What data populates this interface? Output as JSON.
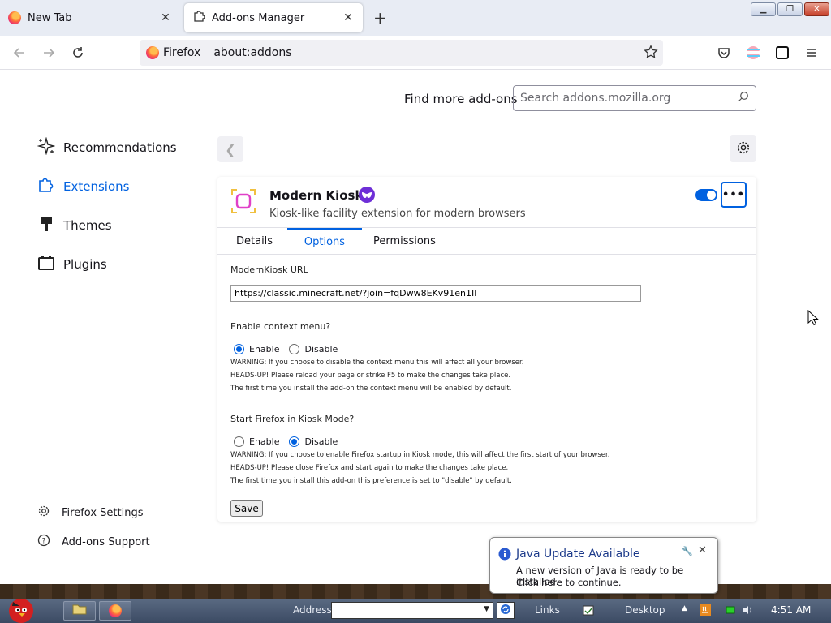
{
  "window": {
    "tabs": [
      {
        "label": "New Tab"
      },
      {
        "label": "Add-ons Manager"
      }
    ]
  },
  "navbar": {
    "identity_label": "Firefox",
    "url": "about:addons"
  },
  "header": {
    "find_more_label": "Find more add-ons",
    "search_placeholder": "Search addons.mozilla.org"
  },
  "sidebar": {
    "items": [
      {
        "label": "Recommendations"
      },
      {
        "label": "Extensions"
      },
      {
        "label": "Themes"
      },
      {
        "label": "Plugins"
      }
    ],
    "footer": [
      {
        "label": "Firefox Settings"
      },
      {
        "label": "Add-ons Support"
      }
    ]
  },
  "addon": {
    "name": "Modern Kiosk",
    "description": "Kiosk-like facility extension for modern browsers",
    "enabled": true,
    "tabs": {
      "details": "Details",
      "options": "Options",
      "permissions": "Permissions"
    }
  },
  "options": {
    "url_label": "ModernKiosk URL",
    "url_value": "https://classic.minecraft.net/?join=fqDww8EKv91en1Il",
    "context_menu": {
      "label": "Enable context menu?",
      "enable_label": "Enable",
      "disable_label": "Disable",
      "selected": "Enable",
      "notes": [
        "WARNING: If you choose to disable the context menu this will affect all your browser.",
        "HEADS-UP! Please reload your page or strike F5 to make the changes take place.",
        "The first time you install the add-on the context menu will be enabled by default."
      ]
    },
    "kiosk_mode": {
      "label": "Start Firefox in Kiosk Mode?",
      "enable_label": "Enable",
      "disable_label": "Disable",
      "selected": "Disable",
      "notes": [
        "WARNING: If you choose to enable Firefox startup in Kiosk mode, this will affect the first start of your browser.",
        "HEADS-UP! Please close Firefox and start again to make the changes take place.",
        "The first time you install this add-on this preference is set to \"disable\" by default."
      ]
    },
    "save_label": "Save"
  },
  "java_popup": {
    "title": "Java Update Available",
    "line1": "A new version of Java is ready to be installed.",
    "line2": "Click here to continue."
  },
  "taskbar": {
    "address_label": "Address",
    "links_label": "Links",
    "desktop_label": "Desktop",
    "clock": "4:51 AM"
  },
  "colors": {
    "accent": "#0061e0",
    "private_badge": "#6e2fd7"
  }
}
